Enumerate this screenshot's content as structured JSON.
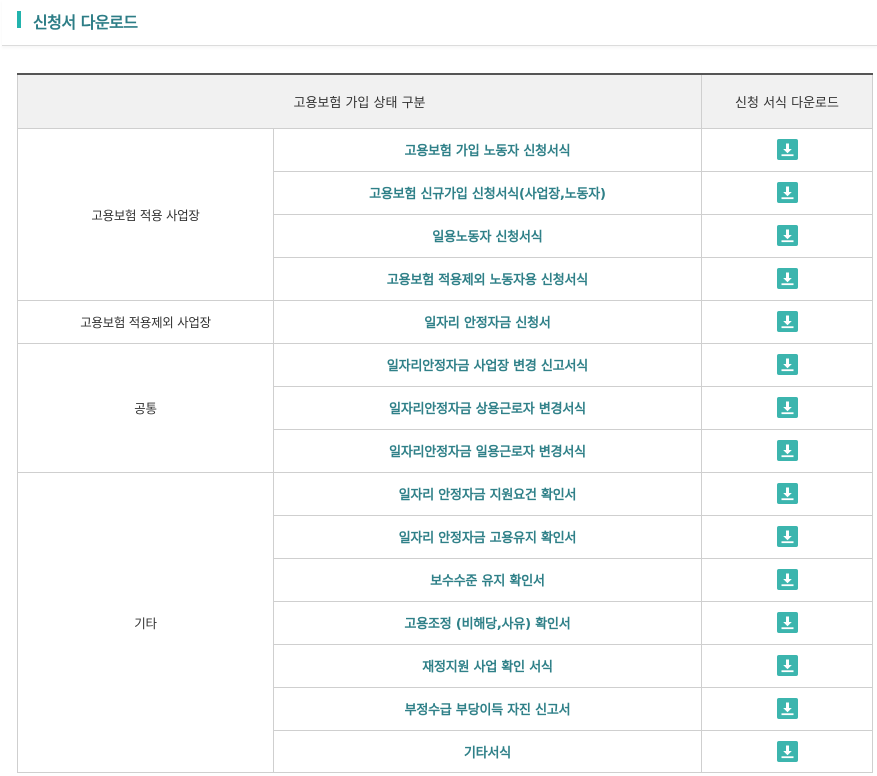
{
  "page": {
    "section_title": "신청서 다운로드"
  },
  "table": {
    "headers": [
      "고용보험 가입 상태 구분",
      "신청 서식 다운로드"
    ],
    "groups": [
      {
        "label": "고용보험 적용 사업장",
        "forms": [
          "고용보험 가입 노동자 신청서식",
          "고용보험 신규가입 신청서식(사업장,노동자)",
          "일용노동자 신청서식",
          "고용보험 적용제외 노동자용 신청서식"
        ]
      },
      {
        "label": "고용보험 적용제외 사업장",
        "forms": [
          "일자리 안정자금 신청서"
        ]
      },
      {
        "label": "공통",
        "forms": [
          "일자리안정자금 사업장 변경 신고서식",
          "일자리안정자금 상용근로자 변경서식",
          "일자리안정자금 일용근로자 변경서식"
        ]
      },
      {
        "label": "기타",
        "forms": [
          "일자리 안정자금 지원요건 확인서",
          "일자리 안정자금 고용유지 확인서",
          "보수수준 유지 확인서",
          "고용조정 (비해당,사유) 확인서",
          "재정지원 사업 확인 서식",
          "부정수급 부당이득 자진 신고서",
          "기타서식"
        ]
      }
    ],
    "download_icon": "download-icon"
  },
  "colors": {
    "accent": "#22b3ad",
    "link_text": "#2f8088",
    "download_button": "#3cb5ae",
    "header_bg": "#f1f1f1"
  }
}
